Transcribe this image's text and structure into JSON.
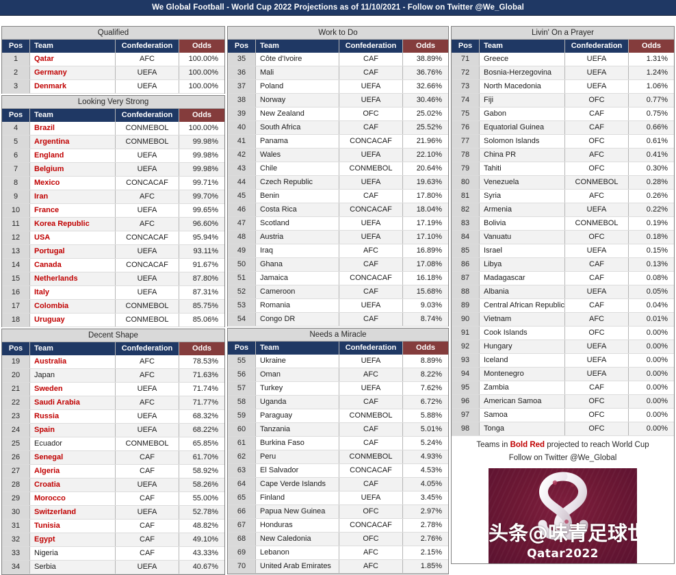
{
  "header": {
    "title": "We Global Football - World Cup 2022 Projections as of 11/10/2021 - Follow on Twitter @We_Global"
  },
  "columns_headers": {
    "pos": "Pos",
    "team": "Team",
    "confederation": "Confederation",
    "odds": "Odds"
  },
  "colors": {
    "header_bar": "#1f3864",
    "table_header": "#1f3864",
    "odds_header": "#843c3c",
    "section_title": "#d9d9d9",
    "qualifying_text": "#c00000",
    "poster_bg": "#6d1834"
  },
  "footer": {
    "legend_prefix": "Teams in ",
    "legend_highlight": "Bold Red",
    "legend_suffix": " projected to reach World Cup",
    "twitter_line": "Follow on Twitter @We_Global",
    "poster_caption": "Qatar2022",
    "watermark": "头条@味青足球世界"
  },
  "sections": [
    {
      "id": "qualified",
      "title": "Qualified",
      "column": 1,
      "rows": [
        {
          "pos": "1",
          "team": "Qatar",
          "conf": "AFC",
          "odds": "100.00%",
          "q": true
        },
        {
          "pos": "2",
          "team": "Germany",
          "conf": "UEFA",
          "odds": "100.00%",
          "q": true
        },
        {
          "pos": "3",
          "team": "Denmark",
          "conf": "UEFA",
          "odds": "100.00%",
          "q": true
        }
      ]
    },
    {
      "id": "looking-very-strong",
      "title": "Looking Very Strong",
      "column": 1,
      "rows": [
        {
          "pos": "4",
          "team": "Brazil",
          "conf": "CONMEBOL",
          "odds": "100.00%",
          "q": true
        },
        {
          "pos": "5",
          "team": "Argentina",
          "conf": "CONMEBOL",
          "odds": "99.98%",
          "q": true
        },
        {
          "pos": "6",
          "team": "England",
          "conf": "UEFA",
          "odds": "99.98%",
          "q": true
        },
        {
          "pos": "7",
          "team": "Belgium",
          "conf": "UEFA",
          "odds": "99.98%",
          "q": true
        },
        {
          "pos": "8",
          "team": "Mexico",
          "conf": "CONCACAF",
          "odds": "99.71%",
          "q": true
        },
        {
          "pos": "9",
          "team": "Iran",
          "conf": "AFC",
          "odds": "99.70%",
          "q": true
        },
        {
          "pos": "10",
          "team": "France",
          "conf": "UEFA",
          "odds": "99.65%",
          "q": true
        },
        {
          "pos": "11",
          "team": "Korea Republic",
          "conf": "AFC",
          "odds": "96.60%",
          "q": true
        },
        {
          "pos": "12",
          "team": "USA",
          "conf": "CONCACAF",
          "odds": "95.94%",
          "q": true
        },
        {
          "pos": "13",
          "team": "Portugal",
          "conf": "UEFA",
          "odds": "93.11%",
          "q": true
        },
        {
          "pos": "14",
          "team": "Canada",
          "conf": "CONCACAF",
          "odds": "91.67%",
          "q": true
        },
        {
          "pos": "15",
          "team": "Netherlands",
          "conf": "UEFA",
          "odds": "87.80%",
          "q": true
        },
        {
          "pos": "16",
          "team": "Italy",
          "conf": "UEFA",
          "odds": "87.31%",
          "q": true
        },
        {
          "pos": "17",
          "team": "Colombia",
          "conf": "CONMEBOL",
          "odds": "85.75%",
          "q": true
        },
        {
          "pos": "18",
          "team": "Uruguay",
          "conf": "CONMEBOL",
          "odds": "85.06%",
          "q": true
        }
      ]
    },
    {
      "id": "decent-shape",
      "title": "Decent Shape",
      "column": 1,
      "rows": [
        {
          "pos": "19",
          "team": "Australia",
          "conf": "AFC",
          "odds": "78.53%",
          "q": true
        },
        {
          "pos": "20",
          "team": "Japan",
          "conf": "AFC",
          "odds": "71.63%",
          "q": false
        },
        {
          "pos": "21",
          "team": "Sweden",
          "conf": "UEFA",
          "odds": "71.74%",
          "q": true
        },
        {
          "pos": "22",
          "team": "Saudi Arabia",
          "conf": "AFC",
          "odds": "71.77%",
          "q": true
        },
        {
          "pos": "23",
          "team": "Russia",
          "conf": "UEFA",
          "odds": "68.32%",
          "q": true
        },
        {
          "pos": "24",
          "team": "Spain",
          "conf": "UEFA",
          "odds": "68.22%",
          "q": true
        },
        {
          "pos": "25",
          "team": "Ecuador",
          "conf": "CONMEBOL",
          "odds": "65.85%",
          "q": false
        },
        {
          "pos": "26",
          "team": "Senegal",
          "conf": "CAF",
          "odds": "61.70%",
          "q": true
        },
        {
          "pos": "27",
          "team": "Algeria",
          "conf": "CAF",
          "odds": "58.92%",
          "q": true
        },
        {
          "pos": "28",
          "team": "Croatia",
          "conf": "UEFA",
          "odds": "58.26%",
          "q": true
        },
        {
          "pos": "29",
          "team": "Morocco",
          "conf": "CAF",
          "odds": "55.00%",
          "q": true
        },
        {
          "pos": "30",
          "team": "Switzerland",
          "conf": "UEFA",
          "odds": "52.78%",
          "q": true
        },
        {
          "pos": "31",
          "team": "Tunisia",
          "conf": "CAF",
          "odds": "48.82%",
          "q": true
        },
        {
          "pos": "32",
          "team": "Egypt",
          "conf": "CAF",
          "odds": "49.10%",
          "q": true
        },
        {
          "pos": "33",
          "team": "Nigeria",
          "conf": "CAF",
          "odds": "43.33%",
          "q": false
        },
        {
          "pos": "34",
          "team": "Serbia",
          "conf": "UEFA",
          "odds": "40.67%",
          "q": false
        }
      ]
    },
    {
      "id": "work-to-do",
      "title": "Work to Do",
      "column": 2,
      "rows": [
        {
          "pos": "35",
          "team": "Côte d'Ivoire",
          "conf": "CAF",
          "odds": "38.89%",
          "q": false
        },
        {
          "pos": "36",
          "team": "Mali",
          "conf": "CAF",
          "odds": "36.76%",
          "q": false
        },
        {
          "pos": "37",
          "team": "Poland",
          "conf": "UEFA",
          "odds": "32.66%",
          "q": false
        },
        {
          "pos": "38",
          "team": "Norway",
          "conf": "UEFA",
          "odds": "30.46%",
          "q": false
        },
        {
          "pos": "39",
          "team": "New Zealand",
          "conf": "OFC",
          "odds": "25.02%",
          "q": false
        },
        {
          "pos": "40",
          "team": "South Africa",
          "conf": "CAF",
          "odds": "25.52%",
          "q": false
        },
        {
          "pos": "41",
          "team": "Panama",
          "conf": "CONCACAF",
          "odds": "21.96%",
          "q": false
        },
        {
          "pos": "42",
          "team": "Wales",
          "conf": "UEFA",
          "odds": "22.10%",
          "q": false
        },
        {
          "pos": "43",
          "team": "Chile",
          "conf": "CONMEBOL",
          "odds": "20.64%",
          "q": false
        },
        {
          "pos": "44",
          "team": "Czech Republic",
          "conf": "UEFA",
          "odds": "19.63%",
          "q": false
        },
        {
          "pos": "45",
          "team": "Benin",
          "conf": "CAF",
          "odds": "17.80%",
          "q": false
        },
        {
          "pos": "46",
          "team": "Costa Rica",
          "conf": "CONCACAF",
          "odds": "18.04%",
          "q": false
        },
        {
          "pos": "47",
          "team": "Scotland",
          "conf": "UEFA",
          "odds": "17.19%",
          "q": false
        },
        {
          "pos": "48",
          "team": "Austria",
          "conf": "UEFA",
          "odds": "17.10%",
          "q": false
        },
        {
          "pos": "49",
          "team": "Iraq",
          "conf": "AFC",
          "odds": "16.89%",
          "q": false
        },
        {
          "pos": "50",
          "team": "Ghana",
          "conf": "CAF",
          "odds": "17.08%",
          "q": false
        },
        {
          "pos": "51",
          "team": "Jamaica",
          "conf": "CONCACAF",
          "odds": "16.18%",
          "q": false
        },
        {
          "pos": "52",
          "team": "Cameroon",
          "conf": "CAF",
          "odds": "15.68%",
          "q": false
        },
        {
          "pos": "53",
          "team": "Romania",
          "conf": "UEFA",
          "odds": "9.03%",
          "q": false
        },
        {
          "pos": "54",
          "team": "Congo DR",
          "conf": "CAF",
          "odds": "8.74%",
          "q": false
        }
      ]
    },
    {
      "id": "needs-a-miracle",
      "title": "Needs a Miracle",
      "column": 2,
      "rows": [
        {
          "pos": "55",
          "team": "Ukraine",
          "conf": "UEFA",
          "odds": "8.89%",
          "q": false
        },
        {
          "pos": "56",
          "team": "Oman",
          "conf": "AFC",
          "odds": "8.22%",
          "q": false
        },
        {
          "pos": "57",
          "team": "Turkey",
          "conf": "UEFA",
          "odds": "7.62%",
          "q": false
        },
        {
          "pos": "58",
          "team": "Uganda",
          "conf": "CAF",
          "odds": "6.72%",
          "q": false
        },
        {
          "pos": "59",
          "team": "Paraguay",
          "conf": "CONMEBOL",
          "odds": "5.88%",
          "q": false
        },
        {
          "pos": "60",
          "team": "Tanzania",
          "conf": "CAF",
          "odds": "5.01%",
          "q": false
        },
        {
          "pos": "61",
          "team": "Burkina Faso",
          "conf": "CAF",
          "odds": "5.24%",
          "q": false
        },
        {
          "pos": "62",
          "team": "Peru",
          "conf": "CONMEBOL",
          "odds": "4.93%",
          "q": false
        },
        {
          "pos": "63",
          "team": "El Salvador",
          "conf": "CONCACAF",
          "odds": "4.53%",
          "q": false
        },
        {
          "pos": "64",
          "team": "Cape Verde Islands",
          "conf": "CAF",
          "odds": "4.05%",
          "q": false
        },
        {
          "pos": "65",
          "team": "Finland",
          "conf": "UEFA",
          "odds": "3.45%",
          "q": false
        },
        {
          "pos": "66",
          "team": "Papua New Guinea",
          "conf": "OFC",
          "odds": "2.97%",
          "q": false
        },
        {
          "pos": "67",
          "team": "Honduras",
          "conf": "CONCACAF",
          "odds": "2.78%",
          "q": false
        },
        {
          "pos": "68",
          "team": "New Caledonia",
          "conf": "OFC",
          "odds": "2.76%",
          "q": false
        },
        {
          "pos": "69",
          "team": "Lebanon",
          "conf": "AFC",
          "odds": "2.15%",
          "q": false
        },
        {
          "pos": "70",
          "team": "United Arab Emirates",
          "conf": "AFC",
          "odds": "1.85%",
          "q": false
        }
      ]
    },
    {
      "id": "livin-on-a-prayer",
      "title": "Livin' On a Prayer",
      "column": 3,
      "rows": [
        {
          "pos": "71",
          "team": "Greece",
          "conf": "UEFA",
          "odds": "1.31%",
          "q": false
        },
        {
          "pos": "72",
          "team": "Bosnia-Herzegovina",
          "conf": "UEFA",
          "odds": "1.24%",
          "q": false
        },
        {
          "pos": "73",
          "team": "North Macedonia",
          "conf": "UEFA",
          "odds": "1.06%",
          "q": false
        },
        {
          "pos": "74",
          "team": "Fiji",
          "conf": "OFC",
          "odds": "0.77%",
          "q": false
        },
        {
          "pos": "75",
          "team": "Gabon",
          "conf": "CAF",
          "odds": "0.75%",
          "q": false
        },
        {
          "pos": "76",
          "team": "Equatorial Guinea",
          "conf": "CAF",
          "odds": "0.66%",
          "q": false
        },
        {
          "pos": "77",
          "team": "Solomon Islands",
          "conf": "OFC",
          "odds": "0.61%",
          "q": false
        },
        {
          "pos": "78",
          "team": "China PR",
          "conf": "AFC",
          "odds": "0.41%",
          "q": false
        },
        {
          "pos": "79",
          "team": "Tahiti",
          "conf": "OFC",
          "odds": "0.30%",
          "q": false
        },
        {
          "pos": "80",
          "team": "Venezuela",
          "conf": "CONMEBOL",
          "odds": "0.28%",
          "q": false
        },
        {
          "pos": "81",
          "team": "Syria",
          "conf": "AFC",
          "odds": "0.26%",
          "q": false
        },
        {
          "pos": "82",
          "team": "Armenia",
          "conf": "UEFA",
          "odds": "0.22%",
          "q": false
        },
        {
          "pos": "83",
          "team": "Bolivia",
          "conf": "CONMEBOL",
          "odds": "0.19%",
          "q": false
        },
        {
          "pos": "84",
          "team": "Vanuatu",
          "conf": "OFC",
          "odds": "0.18%",
          "q": false
        },
        {
          "pos": "85",
          "team": "Israel",
          "conf": "UEFA",
          "odds": "0.15%",
          "q": false
        },
        {
          "pos": "86",
          "team": "Libya",
          "conf": "CAF",
          "odds": "0.13%",
          "q": false
        },
        {
          "pos": "87",
          "team": "Madagascar",
          "conf": "CAF",
          "odds": "0.08%",
          "q": false
        },
        {
          "pos": "88",
          "team": "Albania",
          "conf": "UEFA",
          "odds": "0.05%",
          "q": false
        },
        {
          "pos": "89",
          "team": "Central African Republic",
          "conf": "CAF",
          "odds": "0.04%",
          "q": false
        },
        {
          "pos": "90",
          "team": "Vietnam",
          "conf": "AFC",
          "odds": "0.01%",
          "q": false
        },
        {
          "pos": "91",
          "team": "Cook Islands",
          "conf": "OFC",
          "odds": "0.00%",
          "q": false
        },
        {
          "pos": "92",
          "team": "Hungary",
          "conf": "UEFA",
          "odds": "0.00%",
          "q": false
        },
        {
          "pos": "93",
          "team": "Iceland",
          "conf": "UEFA",
          "odds": "0.00%",
          "q": false
        },
        {
          "pos": "94",
          "team": "Montenegro",
          "conf": "UEFA",
          "odds": "0.00%",
          "q": false
        },
        {
          "pos": "95",
          "team": "Zambia",
          "conf": "CAF",
          "odds": "0.00%",
          "q": false
        },
        {
          "pos": "96",
          "team": "American Samoa",
          "conf": "OFC",
          "odds": "0.00%",
          "q": false
        },
        {
          "pos": "97",
          "team": "Samoa",
          "conf": "OFC",
          "odds": "0.00%",
          "q": false
        },
        {
          "pos": "98",
          "team": "Tonga",
          "conf": "OFC",
          "odds": "0.00%",
          "q": false
        }
      ]
    }
  ]
}
